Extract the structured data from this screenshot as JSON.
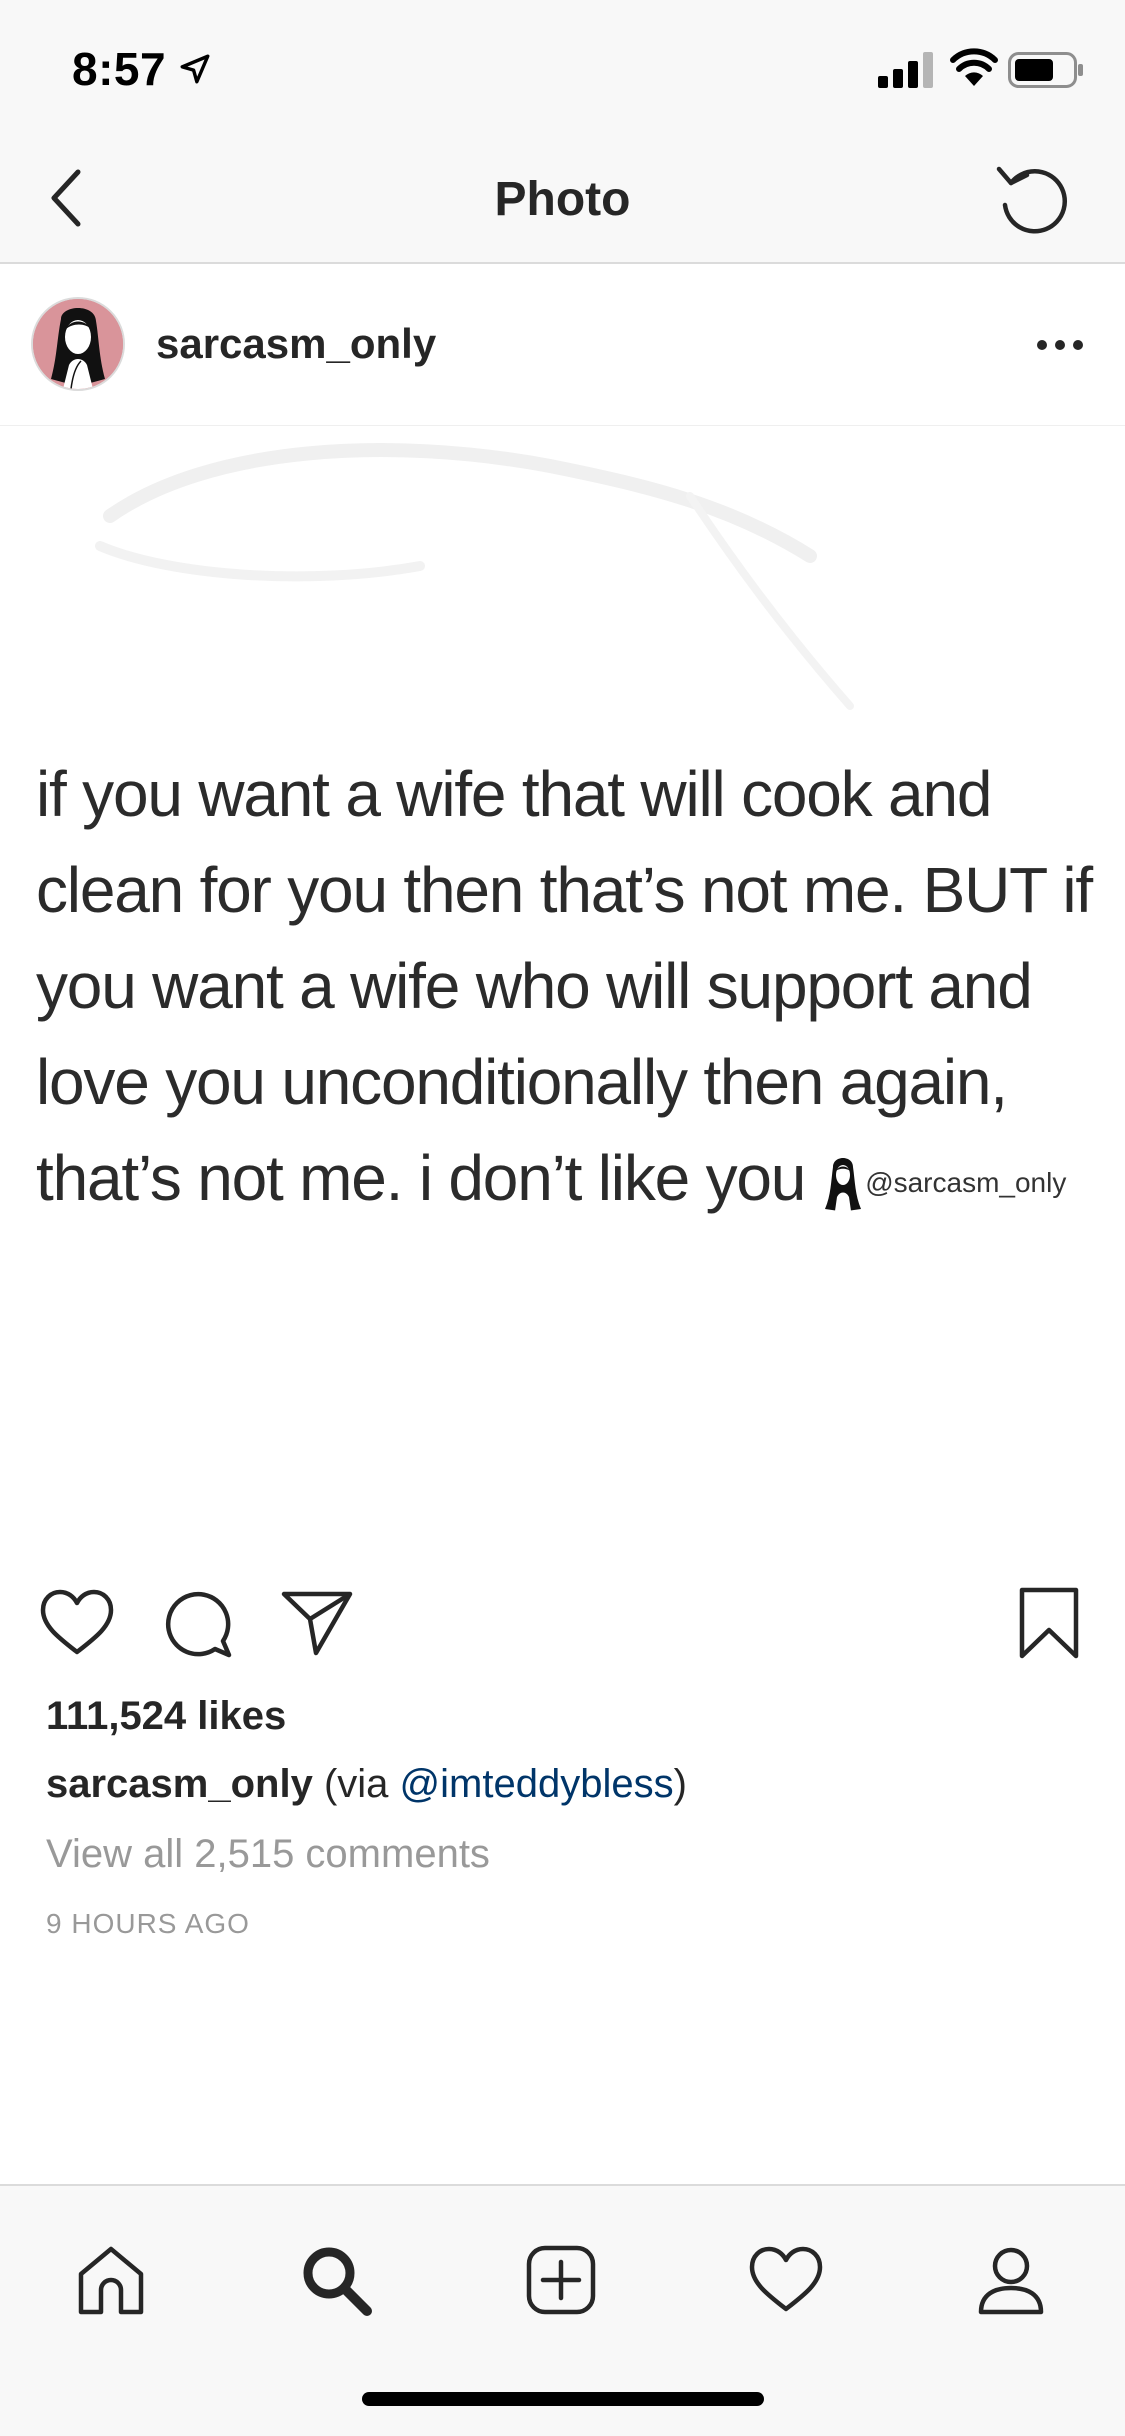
{
  "status_bar": {
    "time": "8:57",
    "icons": [
      "location-arrow-icon",
      "cellular-signal-icon",
      "wifi-icon",
      "battery-icon"
    ]
  },
  "header": {
    "title": "Photo",
    "back_icon": "chevron-left-icon",
    "refresh_icon": "refresh-icon"
  },
  "post": {
    "username": "sarcasm_only",
    "more_icon": "more-horizontal-icon",
    "image_text": {
      "lines": [
        "if you want a wife that will cook and",
        "clean for you then that’s not me. BUT if",
        "you want a wife who will support and",
        "love you unconditionally then again,",
        "that’s not me. i don’t like you"
      ],
      "watermark": "@sarcasm_only"
    },
    "likes": "111,524 likes",
    "caption": {
      "username": "sarcasm_only",
      "via_prefix": " (via ",
      "mention": "@imteddybless",
      "via_suffix": ")"
    },
    "view_comments": "View all 2,515 comments",
    "time_ago": "9 HOURS AGO"
  },
  "actions": [
    "heart-icon",
    "comment-icon",
    "share-icon",
    "bookmark-icon"
  ],
  "tab_bar": {
    "tabs": [
      {
        "name": "home",
        "icon": "home-icon"
      },
      {
        "name": "search",
        "icon": "search-icon",
        "active": true
      },
      {
        "name": "add",
        "icon": "add-post-icon"
      },
      {
        "name": "activity",
        "icon": "heart-icon"
      },
      {
        "name": "profile",
        "icon": "profile-icon"
      }
    ]
  },
  "colors": {
    "text": "#262626",
    "muted": "#999999",
    "mention": "#003569",
    "avatar_bg": "#d9949a",
    "bar_bg": "#f8f8f8"
  }
}
